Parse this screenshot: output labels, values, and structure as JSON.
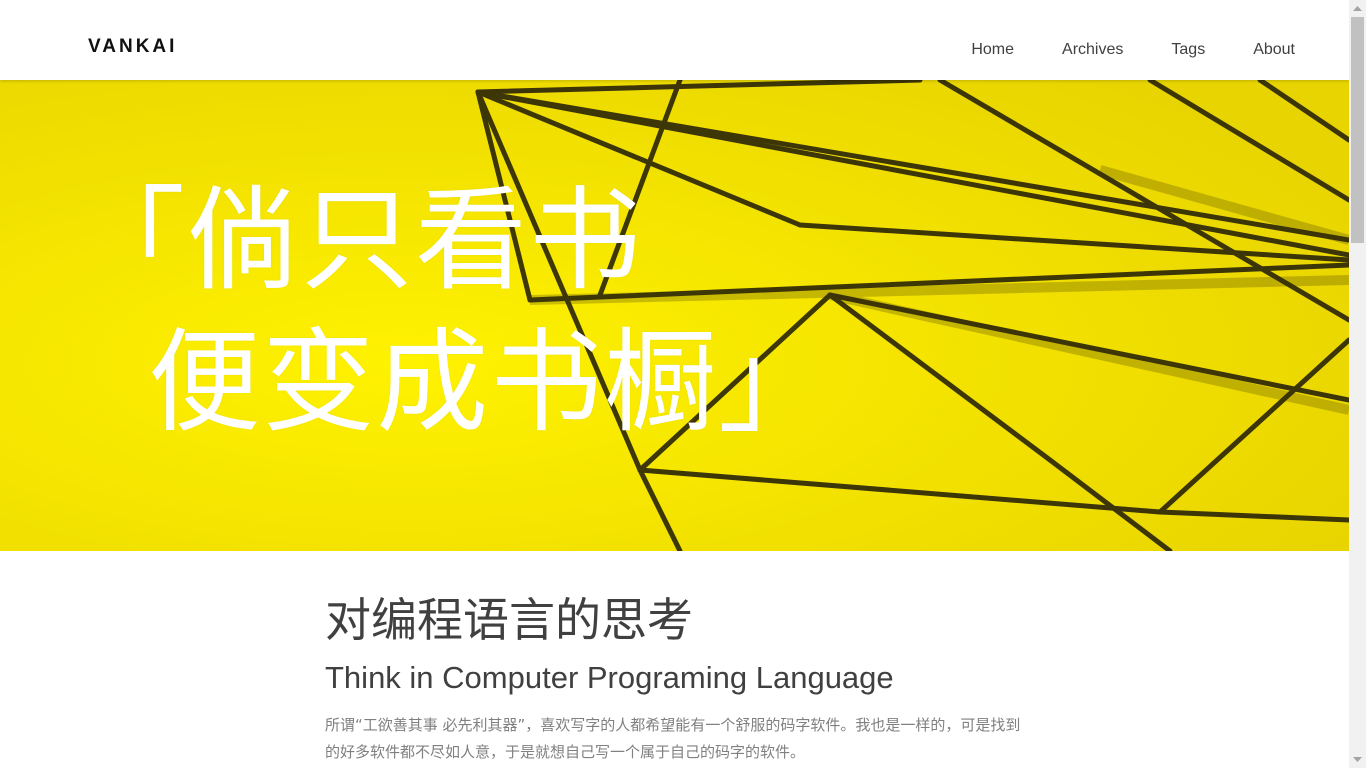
{
  "site": {
    "brand": "VANKAI",
    "nav": [
      "Home",
      "Archives",
      "Tags",
      "About"
    ]
  },
  "hero": {
    "line1": "「倘只看书",
    "line2": "  便变成书橱」",
    "accent_color": "#f6e100",
    "image_icon": "wire-polyhedron"
  },
  "post": {
    "title": "对编程语言的思考",
    "subtitle": "Think in Computer Programing Language",
    "excerpt": "所谓“工欲善其事 必先利其器”，喜欢写字的人都希望能有一个舒服的码字软件。我也是一样的，可是找到的好多软件都不尽如人意，于是就想自己写一个属于自己的码字的软件。"
  },
  "scrollbar": {
    "position": 0
  }
}
